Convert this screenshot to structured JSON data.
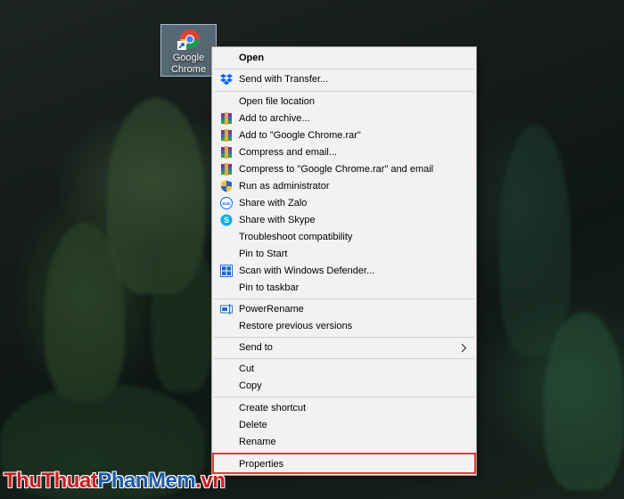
{
  "desktop": {
    "icon_label_line1": "Google",
    "icon_label_line2": "Chrome"
  },
  "menu": {
    "items": [
      {
        "label": "Open",
        "icon": "none",
        "bold": true
      },
      {
        "label": "Send with Transfer...",
        "icon": "dropbox-icon"
      },
      {
        "label": "Open file location",
        "icon": "none"
      },
      {
        "label": "Add to archive...",
        "icon": "winrar-icon"
      },
      {
        "label": "Add to \"Google Chrome.rar\"",
        "icon": "winrar-icon"
      },
      {
        "label": "Compress and email...",
        "icon": "winrar-icon"
      },
      {
        "label": "Compress to \"Google Chrome.rar\" and email",
        "icon": "winrar-icon"
      },
      {
        "label": "Run as administrator",
        "icon": "uac-shield-icon"
      },
      {
        "label": "Share with Zalo",
        "icon": "zalo-icon"
      },
      {
        "label": "Share with Skype",
        "icon": "skype-icon"
      },
      {
        "label": "Troubleshoot compatibility",
        "icon": "none"
      },
      {
        "label": "Pin to Start",
        "icon": "none"
      },
      {
        "label": "Scan with Windows Defender...",
        "icon": "windows-defender-icon"
      },
      {
        "label": "Pin to taskbar",
        "icon": "none"
      },
      {
        "label": "PowerRename",
        "icon": "powerrename-icon"
      },
      {
        "label": "Restore previous versions",
        "icon": "none"
      },
      {
        "label": "Send to",
        "icon": "none",
        "submenu": true
      },
      {
        "label": "Cut",
        "icon": "none"
      },
      {
        "label": "Copy",
        "icon": "none"
      },
      {
        "label": "Create shortcut",
        "icon": "none"
      },
      {
        "label": "Delete",
        "icon": "none"
      },
      {
        "label": "Rename",
        "icon": "none"
      },
      {
        "label": "Properties",
        "icon": "none",
        "highlighted": true
      }
    ]
  },
  "watermark": {
    "part1": "ThuThuat",
    "part2": "PhanMem",
    "part3": ".vn"
  },
  "colors": {
    "highlight_border": "#e8383a",
    "menu_background": "#f2f2f2",
    "watermark_red": "#c62026",
    "watermark_blue": "#1e5aa8"
  }
}
